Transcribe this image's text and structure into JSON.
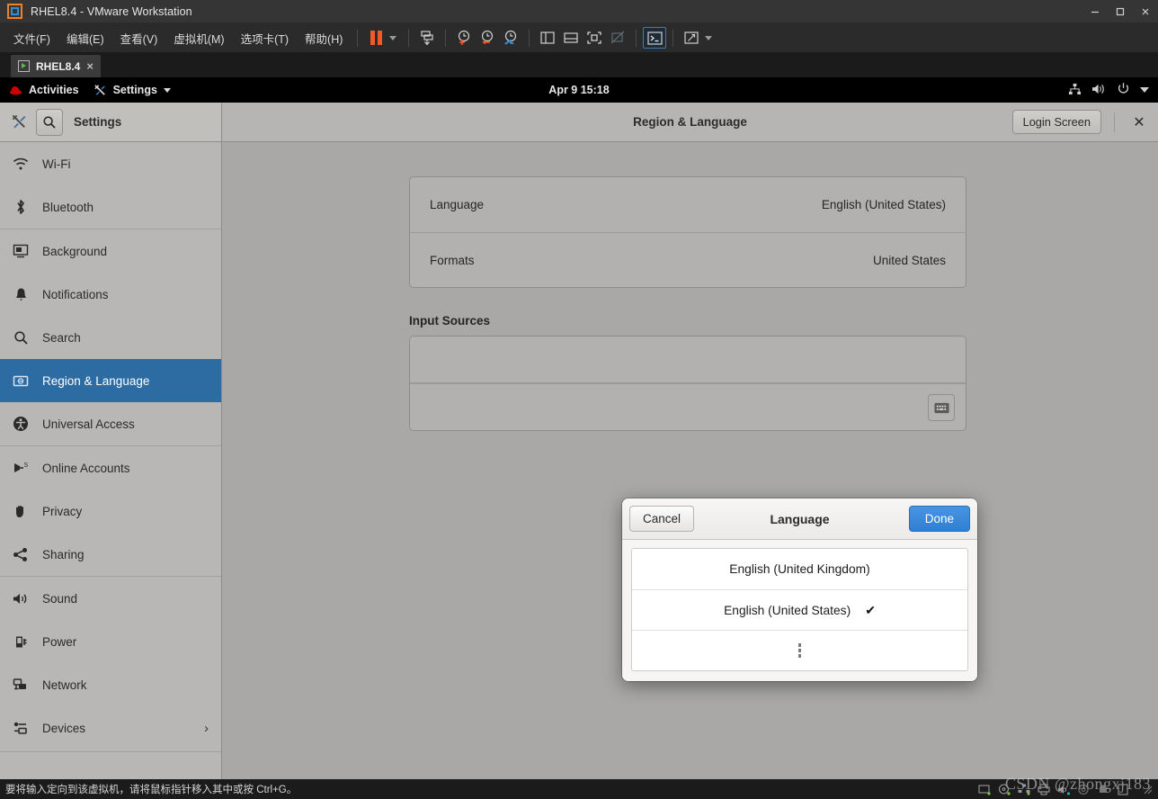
{
  "window": {
    "title": "RHEL8.4 - VMware Workstation",
    "controls": {
      "minimize": "minimize-button",
      "maximize": "maximize-button",
      "close": "close-button"
    }
  },
  "menubar": {
    "items": [
      {
        "label": "文件(F)"
      },
      {
        "label": "编辑(E)"
      },
      {
        "label": "查看(V)"
      },
      {
        "label": "虚拟机(M)"
      },
      {
        "label": "选项卡(T)"
      },
      {
        "label": "帮助(H)"
      }
    ]
  },
  "toolbar": {
    "icons": [
      "pause-icon",
      "dropdown-caret-icon",
      "snapshot-icon",
      "take-snapshot-icon",
      "revert-snapshot-icon",
      "snapshot-manager-icon",
      "show-library-icon",
      "show-thumbnails-icon",
      "fullscreen-icon",
      "unity-mode-icon",
      "console-view-icon",
      "stretch-view-icon"
    ]
  },
  "vmtab": {
    "label": "RHEL8.4",
    "close": "×"
  },
  "gnome": {
    "activities": "Activities",
    "app_menu": "Settings",
    "clock": "Apr 9  15:18",
    "status_icons": [
      "wired-network-icon",
      "volume-icon",
      "power-icon",
      "chevron-down-icon"
    ]
  },
  "settings": {
    "sidebar_header": {
      "tools_icon": "tools-icon",
      "search_icon": "search-icon",
      "title": "Settings"
    },
    "header": {
      "title": "Region & Language",
      "login_screen_button": "Login Screen",
      "close_label": "✕"
    },
    "sidebar": {
      "items": [
        {
          "label": "Wi-Fi",
          "icon": "wifi-icon",
          "selected": false
        },
        {
          "label": "Bluetooth",
          "icon": "bluetooth-icon",
          "selected": false
        },
        {
          "label": "Background",
          "icon": "background-icon",
          "selected": false
        },
        {
          "label": "Notifications",
          "icon": "notifications-icon",
          "selected": false
        },
        {
          "label": "Search",
          "icon": "search-icon",
          "selected": false
        },
        {
          "label": "Region & Language",
          "icon": "region-language-icon",
          "selected": true
        },
        {
          "label": "Universal Access",
          "icon": "universal-access-icon",
          "selected": false
        },
        {
          "label": "Online Accounts",
          "icon": "online-accounts-icon",
          "selected": false
        },
        {
          "label": "Privacy",
          "icon": "privacy-icon",
          "selected": false
        },
        {
          "label": "Sharing",
          "icon": "sharing-icon",
          "selected": false
        },
        {
          "label": "Sound",
          "icon": "sound-icon",
          "selected": false
        },
        {
          "label": "Power",
          "icon": "power-icon",
          "selected": false
        },
        {
          "label": "Network",
          "icon": "network-icon",
          "selected": false
        },
        {
          "label": "Devices",
          "icon": "devices-icon",
          "selected": false,
          "chevron": "›"
        }
      ]
    },
    "main": {
      "rows": [
        {
          "label": "Language",
          "value": "English (United States)"
        },
        {
          "label": "Formats",
          "value": "United States"
        }
      ],
      "input_sources_label": "Input Sources",
      "keyboard_button": "keyboard-icon"
    }
  },
  "dialog": {
    "cancel": "Cancel",
    "title": "Language",
    "done": "Done",
    "options": [
      {
        "label": "English (United Kingdom)",
        "checked": false
      },
      {
        "label": "English (United States)",
        "checked": true
      }
    ],
    "more_indicator": "more-options-icon"
  },
  "statusbar": {
    "message": "要将输入定向到该虚拟机，请将鼠标指针移入其中或按 Ctrl+G。",
    "device_icons": [
      "hard-disk-icon",
      "cd-dvd-icon",
      "network-adapter-icon",
      "printer-icon",
      "sound-card-icon",
      "camera-icon",
      "usb-icon",
      "display-icon"
    ]
  },
  "watermark": "CSDN @zhongxj183",
  "colors": {
    "accent_blue": "#2d6ca3",
    "button_blue": "#3584e4",
    "orange": "#f05a28",
    "gnome_bg": "#a9a8a6",
    "sidebar_bg": "#b8b7b5"
  }
}
